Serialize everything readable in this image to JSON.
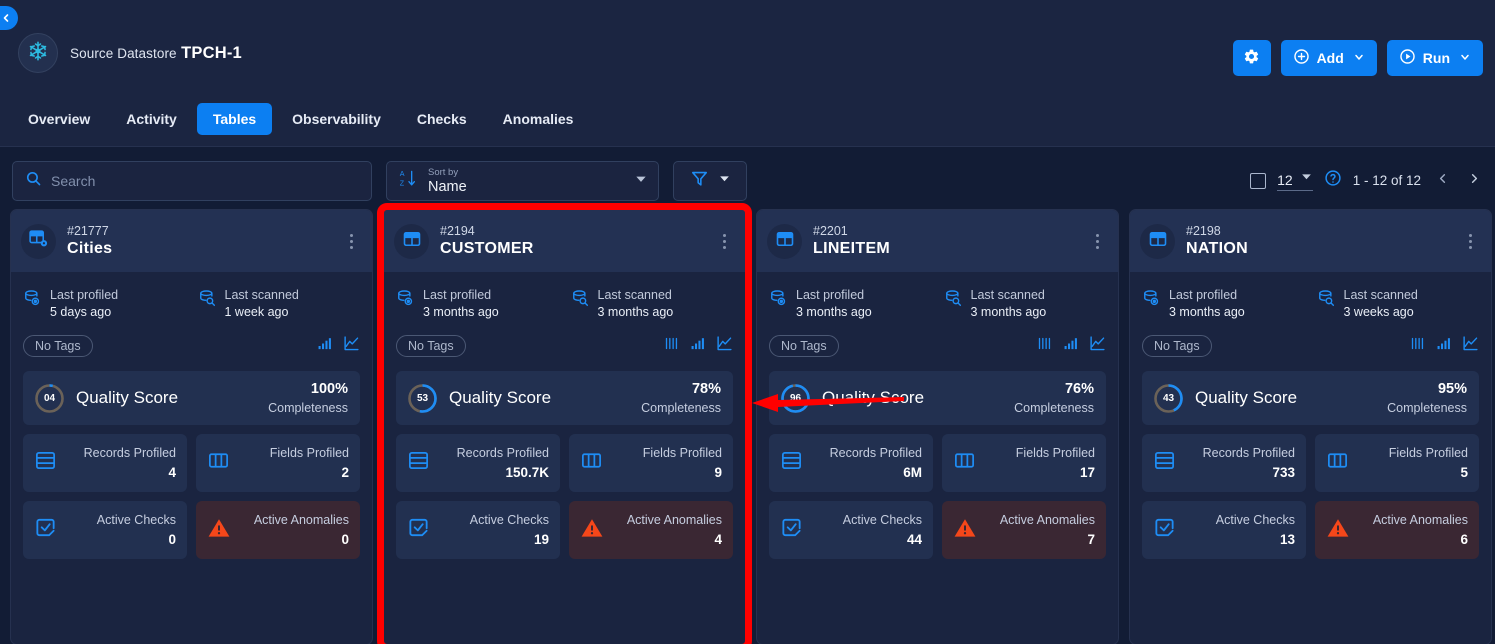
{
  "header": {
    "collapse_icon": "chevron-left-icon",
    "datastore_label": "Source Datastore",
    "datastore_name": "TPCH-1",
    "datastore_icon": "snowflake-icon",
    "settings_icon": "gear-icon",
    "add_label": "Add",
    "add_icon": "plus-circle-icon",
    "run_label": "Run",
    "run_icon": "play-circle-icon",
    "caret_icon": "chevron-down-icon",
    "accent_color": "#0c7ff2"
  },
  "tabs": [
    {
      "label": "Overview",
      "active": false
    },
    {
      "label": "Activity",
      "active": false
    },
    {
      "label": "Tables",
      "active": true
    },
    {
      "label": "Observability",
      "active": false
    },
    {
      "label": "Checks",
      "active": false
    },
    {
      "label": "Anomalies",
      "active": false
    }
  ],
  "toolbar": {
    "search_placeholder": "Search",
    "search_value": "",
    "search_icon": "search-icon",
    "sort_label": "Sort by",
    "sort_value": "Name",
    "sort_icon": "sort-alpha-icon",
    "filter_icon": "filter-icon",
    "pagination": {
      "select_all_checkbox": "",
      "page_size": "12",
      "help_icon": "help-circle-icon",
      "range": "1 - 12 of 12",
      "prev_icon": "chevron-left-icon",
      "next_icon": "chevron-right-icon"
    }
  },
  "cards": [
    {
      "id": "#21777",
      "name": "Cities",
      "icon": "table-gear-icon",
      "highlight": false,
      "last_profiled_label": "Last profiled",
      "last_profiled_value": "5 days ago",
      "last_scanned_label": "Last scanned",
      "last_scanned_value": "1 week ago",
      "tag": "No Tags",
      "chart_icons": [
        "bar-chart-icon",
        "line-chart-icon"
      ],
      "quality_score_value": "04",
      "quality_score_pct": 4,
      "quality_title": "Quality Score",
      "completeness_pct": "100%",
      "completeness_label": "Completeness",
      "stats": [
        {
          "label": "Records Profiled",
          "value": "4",
          "icon": "records-icon",
          "danger": false
        },
        {
          "label": "Fields Profiled",
          "value": "2",
          "icon": "columns-icon",
          "danger": false
        },
        {
          "label": "Active Checks",
          "value": "0",
          "icon": "check-square-icon",
          "danger": false
        },
        {
          "label": "Active Anomalies",
          "value": "0",
          "icon": "warning-triangle-icon",
          "danger": true
        }
      ]
    },
    {
      "id": "#2194",
      "name": "CUSTOMER",
      "icon": "table-icon",
      "highlight": true,
      "last_profiled_label": "Last profiled",
      "last_profiled_value": "3 months ago",
      "last_scanned_label": "Last scanned",
      "last_scanned_value": "3 months ago",
      "tag": "No Tags",
      "chart_icons": [
        "histogram-icon",
        "bar-chart-icon",
        "line-chart-icon"
      ],
      "quality_score_value": "53",
      "quality_score_pct": 53,
      "quality_title": "Quality Score",
      "completeness_pct": "78%",
      "completeness_label": "Completeness",
      "stats": [
        {
          "label": "Records Profiled",
          "value": "150.7K",
          "icon": "records-icon",
          "danger": false
        },
        {
          "label": "Fields Profiled",
          "value": "9",
          "icon": "columns-icon",
          "danger": false
        },
        {
          "label": "Active Checks",
          "value": "19",
          "icon": "check-square-icon",
          "danger": false
        },
        {
          "label": "Active Anomalies",
          "value": "4",
          "icon": "warning-triangle-icon",
          "danger": true
        }
      ]
    },
    {
      "id": "#2201",
      "name": "LINEITEM",
      "icon": "table-icon",
      "highlight": false,
      "last_profiled_label": "Last profiled",
      "last_profiled_value": "3 months ago",
      "last_scanned_label": "Last scanned",
      "last_scanned_value": "3 months ago",
      "tag": "No Tags",
      "chart_icons": [
        "histogram-icon",
        "bar-chart-icon",
        "line-chart-icon"
      ],
      "quality_score_value": "96",
      "quality_score_pct": 96,
      "quality_title": "Quality Score",
      "completeness_pct": "76%",
      "completeness_label": "Completeness",
      "stats": [
        {
          "label": "Records Profiled",
          "value": "6M",
          "icon": "records-icon",
          "danger": false
        },
        {
          "label": "Fields Profiled",
          "value": "17",
          "icon": "columns-icon",
          "danger": false
        },
        {
          "label": "Active Checks",
          "value": "44",
          "icon": "check-square-icon",
          "danger": false
        },
        {
          "label": "Active Anomalies",
          "value": "7",
          "icon": "warning-triangle-icon",
          "danger": true
        }
      ]
    },
    {
      "id": "#2198",
      "name": "NATION",
      "icon": "table-icon",
      "highlight": false,
      "last_profiled_label": "Last profiled",
      "last_profiled_value": "3 months ago",
      "last_scanned_label": "Last scanned",
      "last_scanned_value": "3 weeks ago",
      "tag": "No Tags",
      "chart_icons": [
        "histogram-icon",
        "bar-chart-icon",
        "line-chart-icon"
      ],
      "quality_score_value": "43",
      "quality_score_pct": 43,
      "quality_title": "Quality Score",
      "completeness_pct": "95%",
      "completeness_label": "Completeness",
      "stats": [
        {
          "label": "Records Profiled",
          "value": "733",
          "icon": "records-icon",
          "danger": false
        },
        {
          "label": "Fields Profiled",
          "value": "5",
          "icon": "columns-icon",
          "danger": false
        },
        {
          "label": "Active Checks",
          "value": "13",
          "icon": "check-square-icon",
          "danger": false
        },
        {
          "label": "Active Anomalies",
          "value": "6",
          "icon": "warning-triangle-icon",
          "danger": true
        }
      ]
    }
  ],
  "annotations": {
    "highlight_color": "#ff0000",
    "arrow_icon": "left-arrow-annotation"
  }
}
